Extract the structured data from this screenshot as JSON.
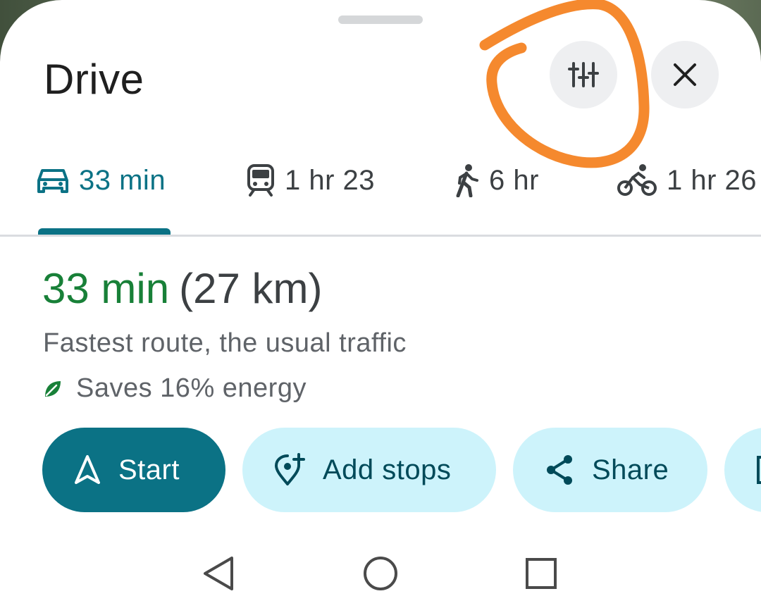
{
  "header": {
    "title": "Drive"
  },
  "tabs": [
    {
      "mode": "drive",
      "icon": "car-icon",
      "label": "33 min",
      "active": true
    },
    {
      "mode": "transit",
      "icon": "train-icon",
      "label": "1 hr 23",
      "active": false
    },
    {
      "mode": "walk",
      "icon": "walking-person-icon",
      "label": "6 hr",
      "active": false
    },
    {
      "mode": "bike",
      "icon": "bicycle-icon",
      "label": "1 hr 26",
      "active": false
    }
  ],
  "route": {
    "time": "33 min",
    "distance": "(27 km)",
    "description": "Fastest route, the usual traffic",
    "eco_text": "Saves 16% energy"
  },
  "actions": {
    "start_label": "Start",
    "add_stops_label": "Add stops",
    "share_label": "Share"
  },
  "colors": {
    "accent": "#0b7285",
    "route_time": "#188038",
    "chip_bg": "#cdf3fb",
    "annotation": "#f5892e"
  }
}
